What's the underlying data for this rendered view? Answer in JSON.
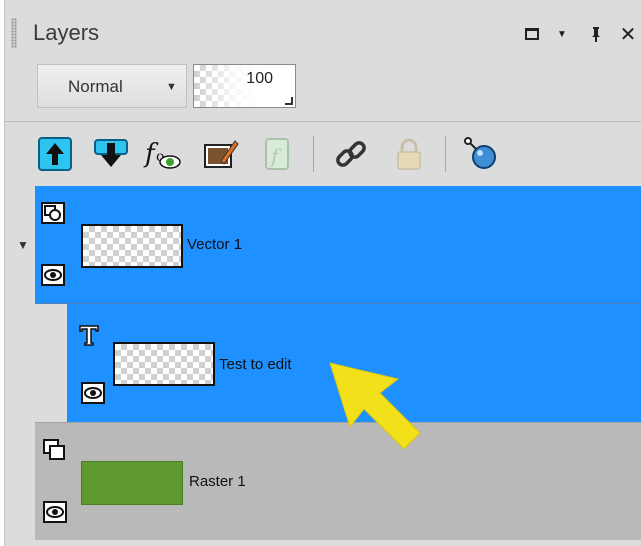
{
  "panel": {
    "title": "Layers",
    "window_controls": [
      "maximize-icon",
      "dropdown-arrow-icon",
      "pin-icon",
      "close-icon"
    ],
    "blend_mode": "Normal",
    "opacity": "100"
  },
  "toolbar": {
    "buttons": [
      {
        "name": "move-layer-up-icon"
      },
      {
        "name": "move-layer-down-icon"
      },
      {
        "name": "layer-effects-visibility-icon"
      },
      {
        "name": "edit-layer-properties-icon"
      },
      {
        "name": "layer-effects-disabled-icon",
        "disabled": true
      },
      {
        "name": "link-layer-icon"
      },
      {
        "name": "lock-layer-icon",
        "disabled": true
      },
      {
        "name": "new-layer-pin-icon"
      }
    ]
  },
  "layers": [
    {
      "name": "Vector 1",
      "type": "vector",
      "selected": true,
      "expanded": true,
      "thumbnail": "transparent"
    },
    {
      "name": "Test to edit",
      "type": "text",
      "selected": true,
      "child": true,
      "thumbnail": "transparent"
    },
    {
      "name": "Raster 1",
      "type": "raster",
      "selected": false,
      "thumbnail_color": "#5e9a2f"
    }
  ],
  "colors": {
    "selection": "#1e90ff",
    "panel_bg": "#dcdcdc",
    "unselected_layer": "#b9b9b9",
    "annotation_arrow": "#f2e01a"
  }
}
